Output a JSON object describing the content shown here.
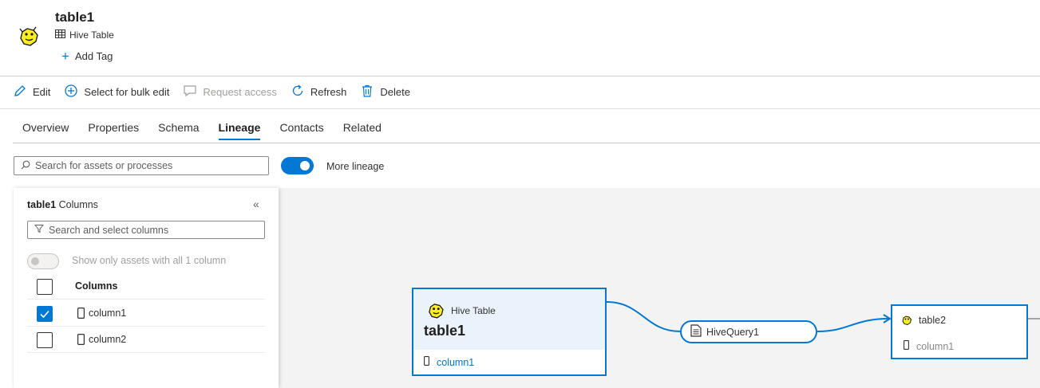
{
  "asset": {
    "title": "table1",
    "type_label": "Hive Table",
    "add_tag_label": "Add Tag"
  },
  "toolbar": {
    "edit": "Edit",
    "bulk_edit": "Select for bulk edit",
    "request_access": "Request access",
    "refresh": "Refresh",
    "delete": "Delete"
  },
  "tabs": [
    "Overview",
    "Properties",
    "Schema",
    "Lineage",
    "Contacts",
    "Related"
  ],
  "active_tab": "Lineage",
  "search": {
    "placeholder": "Search for assets or processes"
  },
  "more_lineage": {
    "label": "More lineage",
    "enabled": true
  },
  "panel": {
    "title_bold": "table1",
    "title_rest": " Columns",
    "collapse_glyph": "«",
    "column_search_placeholder": "Search and select columns",
    "show_only_label": "Show only assets with all 1 column",
    "header_label": "Columns",
    "columns": [
      {
        "name": "column1",
        "checked": true
      },
      {
        "name": "column2",
        "checked": false
      }
    ]
  },
  "lineage": {
    "source": {
      "type": "Hive Table",
      "name": "table1",
      "column": "column1"
    },
    "process": {
      "name": "HiveQuery1"
    },
    "target": {
      "name": "table2",
      "column": "column1"
    }
  },
  "colors": {
    "accent": "#0078d4",
    "hive_yellow": "#fdee21",
    "canvas_bg": "#f3f3f3"
  },
  "icons": [
    "hive-logo-icon",
    "table-icon",
    "plus-icon",
    "edit-icon",
    "add-circle-icon",
    "comment-icon",
    "refresh-icon",
    "delete-icon",
    "search-icon",
    "filter-icon",
    "column-icon",
    "document-icon",
    "chevron-double-left-icon"
  ]
}
